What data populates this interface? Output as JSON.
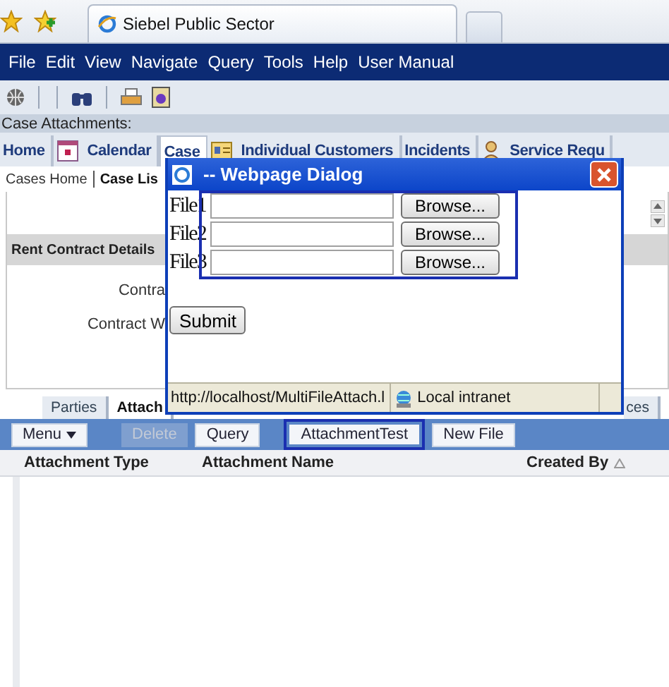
{
  "browser": {
    "tab_title": "Siebel Public Sector"
  },
  "menu": [
    "File",
    "Edit",
    "View",
    "Navigate",
    "Query",
    "Tools",
    "Help",
    "User Manual"
  ],
  "caption": "Case Attachments:",
  "screen_tabs": [
    {
      "label": "Home",
      "selected": false
    },
    {
      "label": "Calendar",
      "selected": false
    },
    {
      "label": "Case",
      "selected": true
    },
    {
      "label": "Individual Customers",
      "selected": false
    },
    {
      "label": "Incidents",
      "selected": false
    },
    {
      "label": "Service Requ",
      "selected": false
    }
  ],
  "subnav": [
    {
      "label": "Cases Home",
      "selected": false
    },
    {
      "label": "Case Lis",
      "selected": true
    }
  ],
  "form": {
    "section": "Rent Contract Details",
    "fields": [
      "Contra",
      "Contract W"
    ]
  },
  "list_tabs": [
    {
      "label": "Parties",
      "selected": false
    },
    {
      "label": "Attach",
      "selected": true
    },
    {
      "label": "ces",
      "selected": false
    }
  ],
  "list_toolbar": [
    {
      "label": "Menu",
      "kind": "menu",
      "disabled": false,
      "highlighted": false
    },
    {
      "label": "Delete",
      "kind": "button",
      "disabled": true,
      "highlighted": false
    },
    {
      "label": "Query",
      "kind": "button",
      "disabled": false,
      "highlighted": false
    },
    {
      "label": "AttachmentTest",
      "kind": "button",
      "disabled": false,
      "highlighted": true
    },
    {
      "label": "New File",
      "kind": "button",
      "disabled": false,
      "highlighted": false
    }
  ],
  "columns": [
    {
      "label": "Attachment Type",
      "sorted": false
    },
    {
      "label": "Attachment Name",
      "sorted": false
    },
    {
      "label": "Created By",
      "sorted": true
    }
  ],
  "dialog": {
    "title": "-- Webpage Dialog",
    "files": [
      {
        "label": "File1",
        "button": "Browse..."
      },
      {
        "label": "File2",
        "button": "Browse..."
      },
      {
        "label": "File3",
        "button": "Browse..."
      }
    ],
    "submit": "Submit",
    "status_url": "http://localhost/MultiFileAttach.l",
    "zone": "Local intranet"
  }
}
